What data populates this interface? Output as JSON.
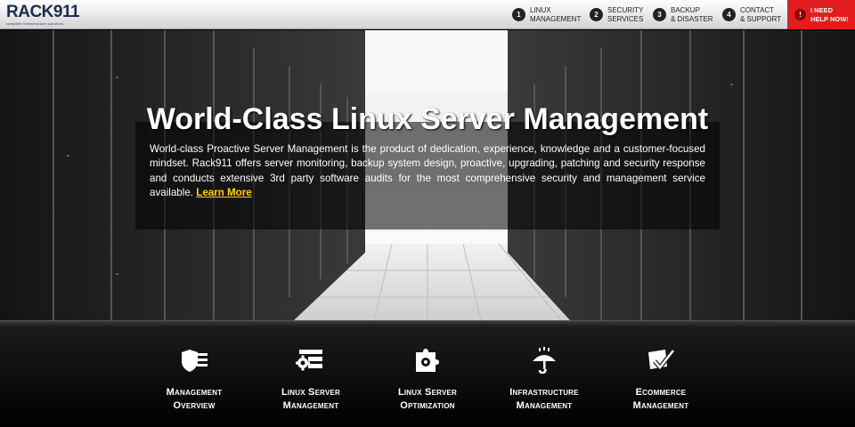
{
  "logo": {
    "name": "RACK911",
    "tagline": "complete infrastructure solutions"
  },
  "nav": [
    {
      "num": "1",
      "line1": "LINUX",
      "line2": "MANAGEMENT"
    },
    {
      "num": "2",
      "line1": "SECURITY",
      "line2": "SERVICES"
    },
    {
      "num": "3",
      "line1": "BACKUP",
      "line2": "& DISASTER"
    },
    {
      "num": "4",
      "line1": "CONTACT",
      "line2": "& SUPPORT"
    }
  ],
  "help": {
    "icon": "!",
    "line1": "I NEED",
    "line2": "HELP NOW!"
  },
  "hero": {
    "title": "World-Class Linux Server Management",
    "description": "World-class Proactive Server Management is the product of dedication, experience, knowledge and a customer-focused mindset. Rack911 offers server monitoring, backup system design, proactive, upgrading, patching and security response and conducts extensive 3rd party software audits for the most comprehensive security and management service available.",
    "link": "Learn More"
  },
  "services": [
    {
      "icon": "shield-list-icon",
      "line1": "Management",
      "line2": "Overview"
    },
    {
      "icon": "gear-list-icon",
      "line1": "Linux Server",
      "line2": "Management"
    },
    {
      "icon": "puzzle-gear-icon",
      "line1": "Linux Server",
      "line2": "Optimization"
    },
    {
      "icon": "umbrella-rain-icon",
      "line1": "Infrastructure",
      "line2": "Management"
    },
    {
      "icon": "pci-check-icon",
      "line1": "Ecommerce",
      "line2": "Management"
    }
  ],
  "colors": {
    "help_bg": "#e31d1d",
    "link": "#ffd200",
    "logo": "#1e2b52"
  }
}
